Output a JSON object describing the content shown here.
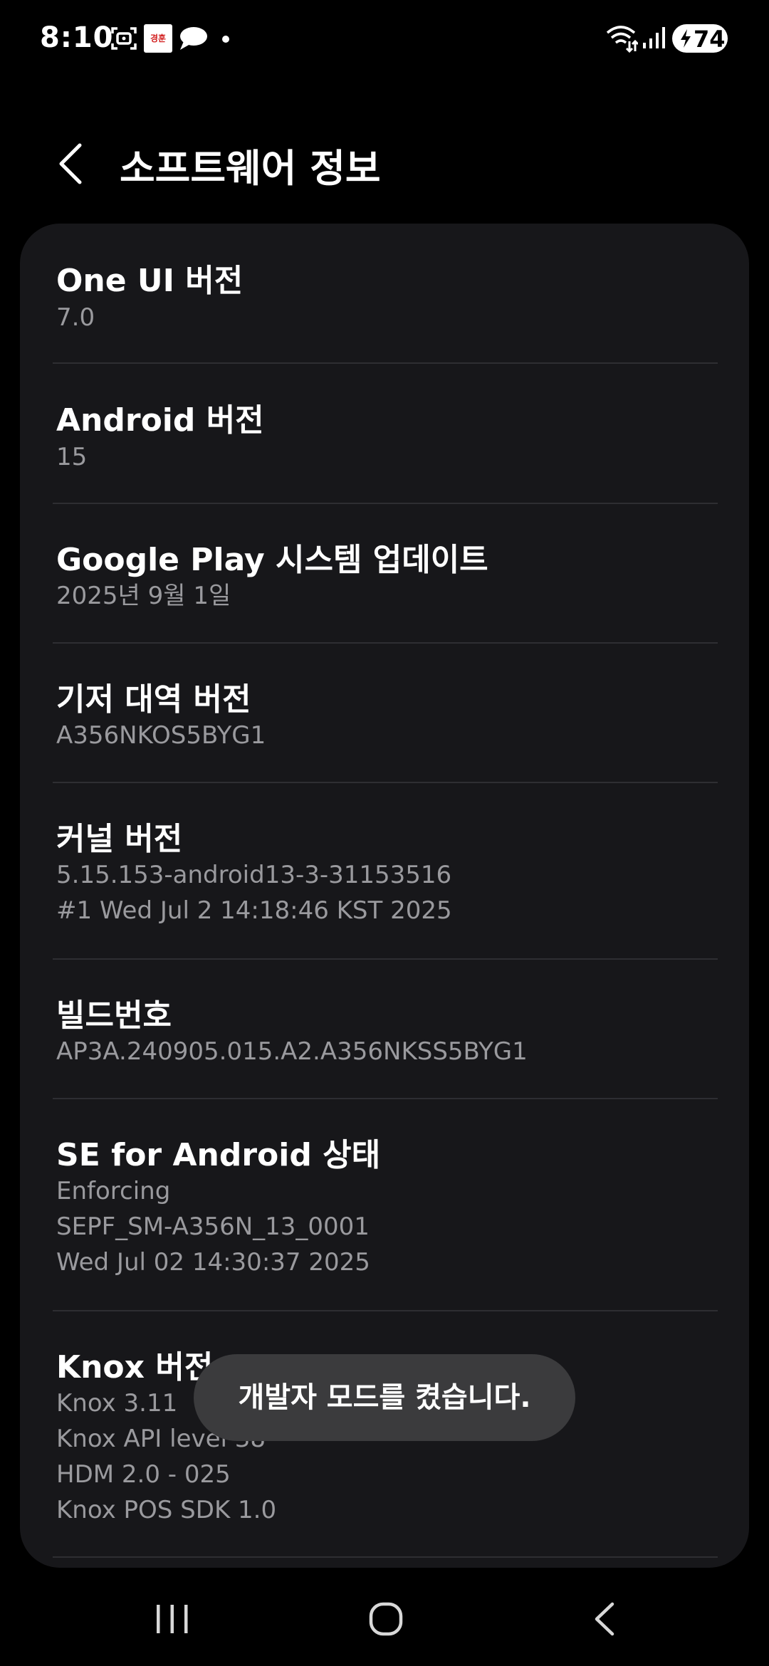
{
  "status_bar": {
    "time": "8:10",
    "app_badge_text": "경훈",
    "battery_level": "74",
    "icons": [
      "screenshot-icon",
      "app-badge-icon",
      "talk-icon",
      "notification-dot-icon",
      "wifi-data-icon",
      "signal-icon",
      "battery-charging-icon"
    ]
  },
  "header": {
    "title": "소프트웨어 정보",
    "back_icon": "back-arrow-icon"
  },
  "items": [
    {
      "title": "One UI 버전",
      "values": [
        "7.0"
      ]
    },
    {
      "title": "Android 버전",
      "values": [
        "15"
      ]
    },
    {
      "title": "Google Play 시스템 업데이트",
      "values": [
        "2025년 9월 1일"
      ]
    },
    {
      "title": "기저 대역 버전",
      "values": [
        "A356NKOS5BYG1"
      ]
    },
    {
      "title": "커널 버전",
      "values": [
        "5.15.153-android13-3-31153516",
        "#1 Wed Jul 2 14:18:46 KST 2025"
      ]
    },
    {
      "title": "빌드번호",
      "values": [
        "AP3A.240905.015.A2.A356NKSS5BYG1"
      ]
    },
    {
      "title": "SE for Android 상태",
      "values": [
        "Enforcing",
        "SEPF_SM-A356N_13_0001",
        "Wed Jul 02 14:30:37 2025"
      ]
    },
    {
      "title": "Knox 버전",
      "values": [
        "Knox 3.11",
        "Knox API level 38",
        "HDM 2.0 - 025",
        "Knox POS SDK 1.0"
      ]
    }
  ],
  "toast": {
    "message": "개발자 모드를 켰습니다."
  },
  "nav_bar": {
    "icons": [
      "recent-apps-icon",
      "home-icon",
      "back-icon"
    ]
  },
  "colors": {
    "background": "#000000",
    "card": "#17171a",
    "title_text": "#ffffff",
    "secondary_text": "#9a9a9e",
    "divider": "#2e2e32",
    "toast": "#3b3b3d"
  }
}
